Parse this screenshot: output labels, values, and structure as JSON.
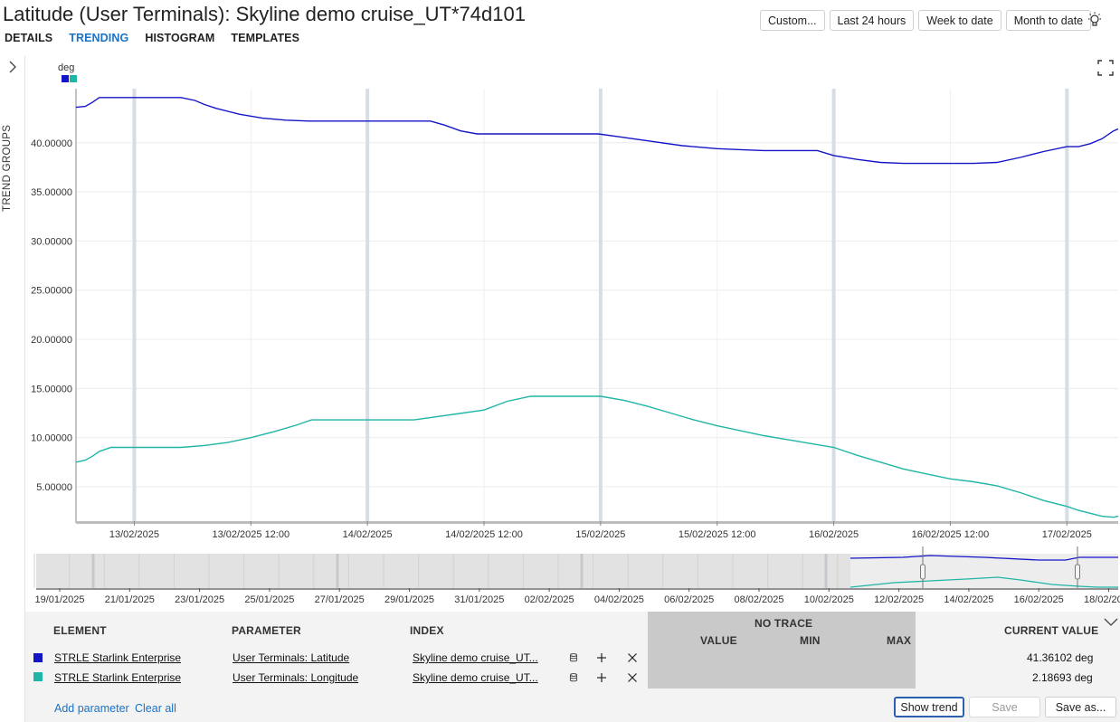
{
  "header": {
    "title": "Latitude (User Terminals): Skyline demo cruise_UT*74d101",
    "tabs": [
      "DETAILS",
      "TRENDING",
      "HISTOGRAM",
      "TEMPLATES"
    ],
    "active_tab": "TRENDING",
    "range_buttons": [
      "Custom...",
      "Last 24 hours",
      "Week to date",
      "Month to date"
    ],
    "bulb_icon": "lightbulb-icon"
  },
  "sidebar": {
    "label": "TREND GROUPS",
    "icon": "chevron-right-icon"
  },
  "fullscreen_icon": "fullscreen-icon",
  "chart_data": {
    "type": "line",
    "unit_label": "deg",
    "y_ticks": [
      "5.00000",
      "10.00000",
      "15.00000",
      "20.00000",
      "25.00000",
      "30.00000",
      "35.00000",
      "40.00000"
    ],
    "ylim": [
      1.5,
      45.5
    ],
    "x_tick_labels": [
      "13/02/2025",
      "13/02/2025 12:00",
      "14/02/2025",
      "14/02/2025 12:00",
      "15/02/2025",
      "15/02/2025 12:00",
      "16/02/2025",
      "16/02/2025 12:00",
      "17/02/2025"
    ],
    "x_ticks_days": [
      1,
      1.5,
      2,
      2.5,
      3,
      3.5,
      4,
      4.5,
      5
    ],
    "x_range_days": [
      0.75,
      5.22
    ],
    "day_markers_days": [
      1,
      2,
      3,
      4,
      5
    ],
    "grid": true,
    "series": [
      {
        "color": "#1515c8",
        "x": [
          0.75,
          0.79,
          0.82,
          0.85,
          0.9,
          1.0,
          1.1,
          1.2,
          1.26,
          1.3,
          1.35,
          1.45,
          1.55,
          1.65,
          1.75,
          1.85,
          2.0,
          2.2,
          2.27,
          2.33,
          2.4,
          2.47,
          2.6,
          2.8,
          2.99,
          3.08,
          3.2,
          3.35,
          3.5,
          3.6,
          3.7,
          3.8,
          3.93,
          4.0,
          4.1,
          4.2,
          4.3,
          4.5,
          4.6,
          4.7,
          4.8,
          4.9,
          5.0,
          5.05,
          5.1,
          5.15,
          5.2,
          5.22
        ],
        "y": [
          43.6,
          43.7,
          44.1,
          44.6,
          44.6,
          44.6,
          44.6,
          44.6,
          44.3,
          43.9,
          43.5,
          42.9,
          42.5,
          42.3,
          42.2,
          42.2,
          42.2,
          42.2,
          42.2,
          41.8,
          41.2,
          40.9,
          40.9,
          40.9,
          40.9,
          40.6,
          40.2,
          39.7,
          39.4,
          39.3,
          39.2,
          39.2,
          39.2,
          38.7,
          38.3,
          38.0,
          37.9,
          37.9,
          37.9,
          38.0,
          38.5,
          39.1,
          39.6,
          39.6,
          39.9,
          40.4,
          41.2,
          41.4
        ]
      },
      {
        "color": "#20b5a6",
        "x": [
          0.75,
          0.79,
          0.82,
          0.85,
          0.9,
          1.0,
          1.1,
          1.2,
          1.3,
          1.4,
          1.5,
          1.6,
          1.7,
          1.76,
          1.85,
          2.0,
          2.2,
          2.5,
          2.6,
          2.7,
          2.8,
          2.9,
          3.0,
          3.1,
          3.2,
          3.3,
          3.4,
          3.5,
          3.6,
          3.7,
          3.8,
          3.9,
          4.0,
          4.1,
          4.2,
          4.3,
          4.4,
          4.5,
          4.6,
          4.7,
          4.8,
          4.9,
          5.0,
          5.05,
          5.1,
          5.15,
          5.2,
          5.22
        ],
        "y": [
          7.5,
          7.7,
          8.1,
          8.6,
          9.0,
          9.0,
          9.0,
          9.0,
          9.2,
          9.5,
          10.0,
          10.6,
          11.3,
          11.8,
          11.8,
          11.8,
          11.8,
          12.8,
          13.7,
          14.2,
          14.2,
          14.2,
          14.2,
          13.8,
          13.2,
          12.5,
          11.8,
          11.2,
          10.7,
          10.2,
          9.8,
          9.4,
          9.0,
          8.2,
          7.5,
          6.8,
          6.3,
          5.8,
          5.5,
          5.1,
          4.4,
          3.6,
          3.0,
          2.6,
          2.3,
          2.0,
          1.9,
          2.0
        ]
      }
    ]
  },
  "navigator": {
    "x_tick_labels": [
      "19/01/2025",
      "21/01/2025",
      "23/01/2025",
      "25/01/2025",
      "27/01/2025",
      "29/01/2025",
      "31/01/2025",
      "02/02/2025",
      "04/02/2025",
      "06/02/2025",
      "08/02/2025",
      "10/02/2025",
      "12/02/2025",
      "14/02/2025",
      "16/02/2025",
      "18/02/2025"
    ]
  },
  "table": {
    "headers": {
      "element": "ELEMENT",
      "parameter": "PARAMETER",
      "index": "INDEX",
      "no_trace": "NO TRACE",
      "value": "VALUE",
      "min": "MIN",
      "max": "MAX",
      "current": "CURRENT VALUE"
    },
    "rows": [
      {
        "color": "#1515c8",
        "element": "STRLE Starlink Enterprise",
        "parameter": "User Terminals: Latitude",
        "index": "Skyline demo cruise_UT...",
        "current": "41.36102 deg"
      },
      {
        "color": "#20b5a6",
        "element": "STRLE Starlink Enterprise",
        "parameter": "User Terminals: Longitude",
        "index": "Skyline demo cruise_UT...",
        "current": "2.18693 deg"
      }
    ],
    "row_icons": [
      "database-icon",
      "plus-icon",
      "close-icon"
    ]
  },
  "footer": {
    "add_parameter": "Add parameter",
    "clear_all": "Clear all",
    "show_trend": "Show trend",
    "save": "Save",
    "save_as": "Save as..."
  }
}
